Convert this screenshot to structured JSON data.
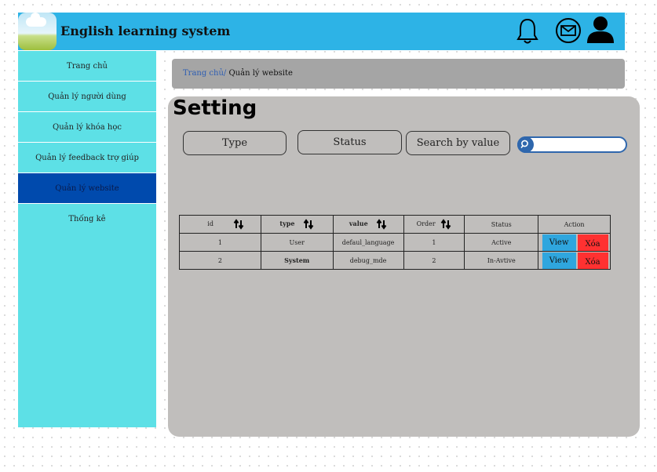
{
  "header": {
    "title": "English learning system",
    "color": "#2db3e6"
  },
  "sidebar": {
    "items": [
      {
        "label": "Trang chủ"
      },
      {
        "label": "Quản lý người dùng"
      },
      {
        "label": "Quản lý khóa học"
      },
      {
        "label": "Quản lý feedback trợ giúp"
      },
      {
        "label": "Quản lý website",
        "active": true
      },
      {
        "label": "Thống kê"
      }
    ]
  },
  "breadcrumb": {
    "home": "Trang chủ/",
    "current": "Quản lý website"
  },
  "main": {
    "title": "Setting",
    "filters": {
      "type": "Type",
      "status": "Status",
      "search_by_value": "Search by value"
    },
    "search": {
      "value": "",
      "placeholder": ""
    }
  },
  "table": {
    "headers": {
      "id": "id",
      "type": "type",
      "value": "value",
      "order": "Order",
      "status": "Status",
      "action": "Action"
    },
    "rows": [
      {
        "id": "1",
        "type": "User",
        "value": "defaul_language",
        "order": "1",
        "status": "Active",
        "view": "View",
        "delete": "Xóa"
      },
      {
        "id": "2",
        "type": "System",
        "value": "debug_mde",
        "order": "2",
        "status": "In-Avtive",
        "view": "View",
        "delete": "Xóa"
      }
    ]
  },
  "icons": [
    "logo-icon",
    "bell-icon",
    "mail-icon",
    "user-icon",
    "search-icon",
    "sort-icon"
  ]
}
